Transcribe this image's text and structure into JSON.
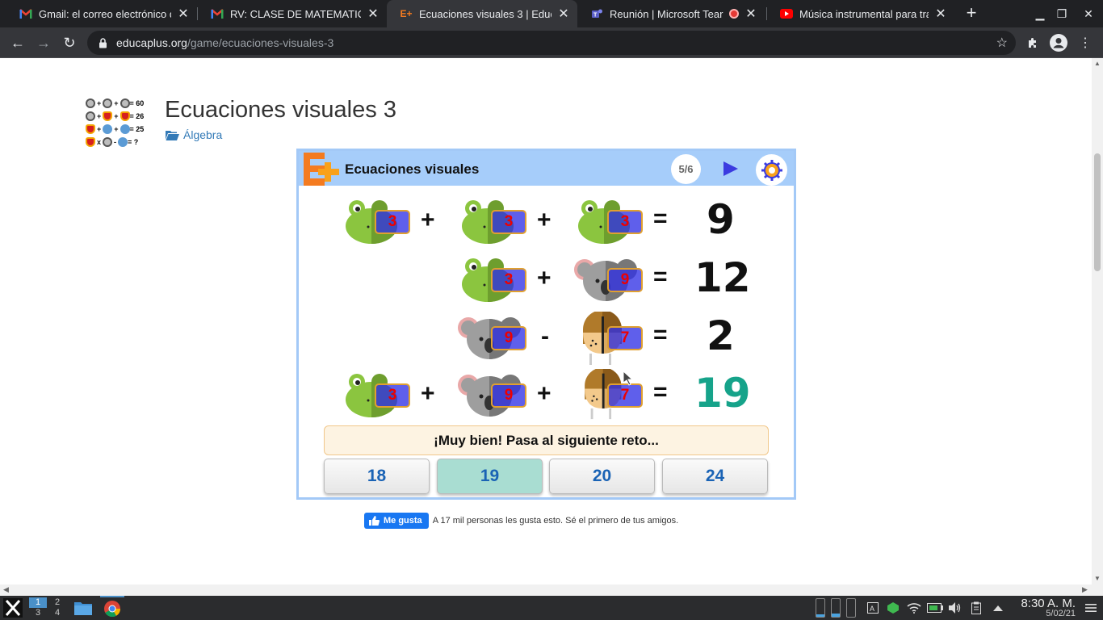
{
  "browser": {
    "tabs": [
      {
        "title": "Gmail: el correo electrónico de",
        "favicon": "gmail-icon",
        "active": false
      },
      {
        "title": "RV: CLASE DE MATEMATICAS",
        "favicon": "gmail-icon",
        "active": false
      },
      {
        "title": "Ecuaciones visuales 3 | Educ",
        "favicon": "educaplus-icon",
        "active": true
      },
      {
        "title": "Reunión | Microsoft Tear",
        "favicon": "teams-icon",
        "active": false
      },
      {
        "title": "Música instrumental para tra",
        "favicon": "youtube-icon",
        "active": false
      }
    ],
    "url_host": "educaplus.org",
    "url_path": "/game/ecuaciones-visuales-3"
  },
  "page": {
    "title": "Ecuaciones visuales 3",
    "category": "Álgebra",
    "thumb": {
      "rows": [
        {
          "ops": [
            "+",
            "+"
          ],
          "result": "= 60"
        },
        {
          "ops": [
            "+",
            "+"
          ],
          "result": "= 26"
        },
        {
          "ops": [
            "+",
            "+"
          ],
          "result": "= 25"
        },
        {
          "ops": [
            "x",
            "-"
          ],
          "result": "= ?"
        }
      ]
    }
  },
  "game": {
    "header_title": "Ecuaciones visuales",
    "progress": "5/6",
    "rows": [
      {
        "terms": [
          "frog",
          "frog",
          "frog"
        ],
        "values": [
          "3",
          "3",
          "3"
        ],
        "ops": [
          "+",
          "+"
        ],
        "result": "9"
      },
      {
        "terms": [
          "frog",
          "koala"
        ],
        "values": [
          "3",
          "9"
        ],
        "ops": [
          "+"
        ],
        "result": "12"
      },
      {
        "terms": [
          "koala",
          "dog"
        ],
        "values": [
          "9",
          "7"
        ],
        "ops": [
          "-"
        ],
        "result": "2"
      },
      {
        "terms": [
          "frog",
          "koala",
          "dog"
        ],
        "values": [
          "3",
          "9",
          "7"
        ],
        "ops": [
          "+",
          "+"
        ],
        "result": "19"
      }
    ],
    "equals": "=",
    "feedback": "¡Muy bien! Pasa al siguiente reto...",
    "options": [
      "18",
      "19",
      "20",
      "24"
    ],
    "correct_option": "19"
  },
  "facebook": {
    "like_label": "Me gusta",
    "like_text": "A 17 mil personas les gusta esto. Sé el primero de tus amigos."
  },
  "taskbar": {
    "workspaces": [
      "1",
      "2",
      "3",
      "4"
    ],
    "time": "8:30 A. M.",
    "date": "5/02/21"
  },
  "colors": {
    "header_blue": "#a6cdfa",
    "value_box": "#3232e6",
    "answer_teal": "#16a38a",
    "option_blue": "#1a63b5"
  }
}
